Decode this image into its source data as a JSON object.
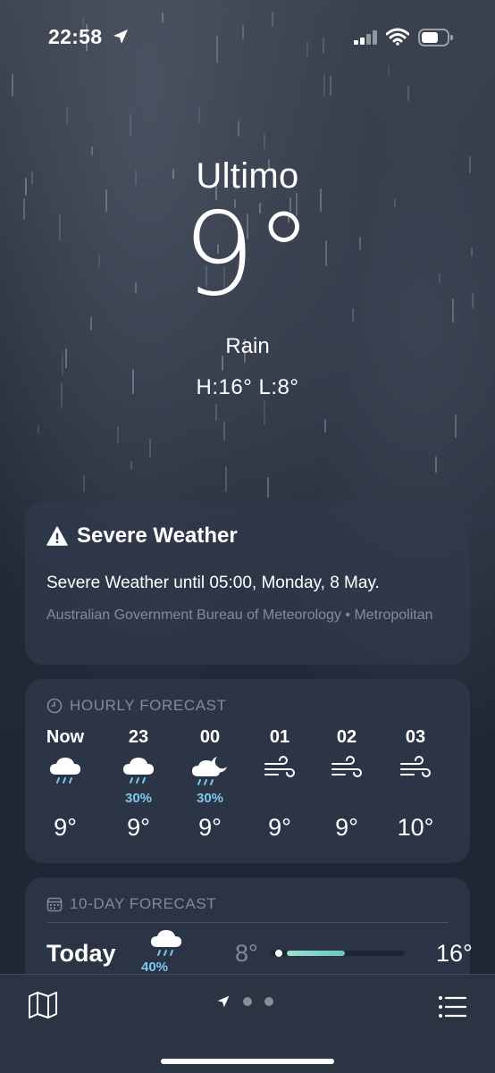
{
  "status_bar": {
    "time": "22:58"
  },
  "location": {
    "name": "Ultimo",
    "temperature": "9°",
    "condition": "Rain",
    "high_low": "H:16°  L:8°"
  },
  "severe_weather": {
    "title": "Severe Weather",
    "message": "Severe Weather until 05:00, Monday, 8 May.",
    "source": "Australian Government Bureau of Meteorology • Metropolitan"
  },
  "hourly": {
    "header": "HOURLY FORECAST",
    "items": [
      {
        "label": "Now",
        "icon": "cloud-rain-icon",
        "pop": "",
        "temp": "9°"
      },
      {
        "label": "23",
        "icon": "cloud-rain-icon",
        "pop": "30%",
        "temp": "9°"
      },
      {
        "label": "00",
        "icon": "moon-cloud-rain-icon",
        "pop": "30%",
        "temp": "9°"
      },
      {
        "label": "01",
        "icon": "wind-icon",
        "pop": "",
        "temp": "9°"
      },
      {
        "label": "02",
        "icon": "wind-icon",
        "pop": "",
        "temp": "9°"
      },
      {
        "label": "03",
        "icon": "wind-icon",
        "pop": "",
        "temp": "10°"
      }
    ]
  },
  "daily": {
    "header": "10-DAY FORECAST",
    "rows": [
      {
        "day": "Today",
        "icon": "cloud-rain-icon",
        "pop": "40%",
        "low": "8°",
        "high": "16°",
        "range_start": 0.12,
        "range_end": 0.55,
        "current": 0.06
      }
    ]
  },
  "colors": {
    "accent_precip": "#7ec8f2",
    "temp_bar": "#66c6c0"
  }
}
